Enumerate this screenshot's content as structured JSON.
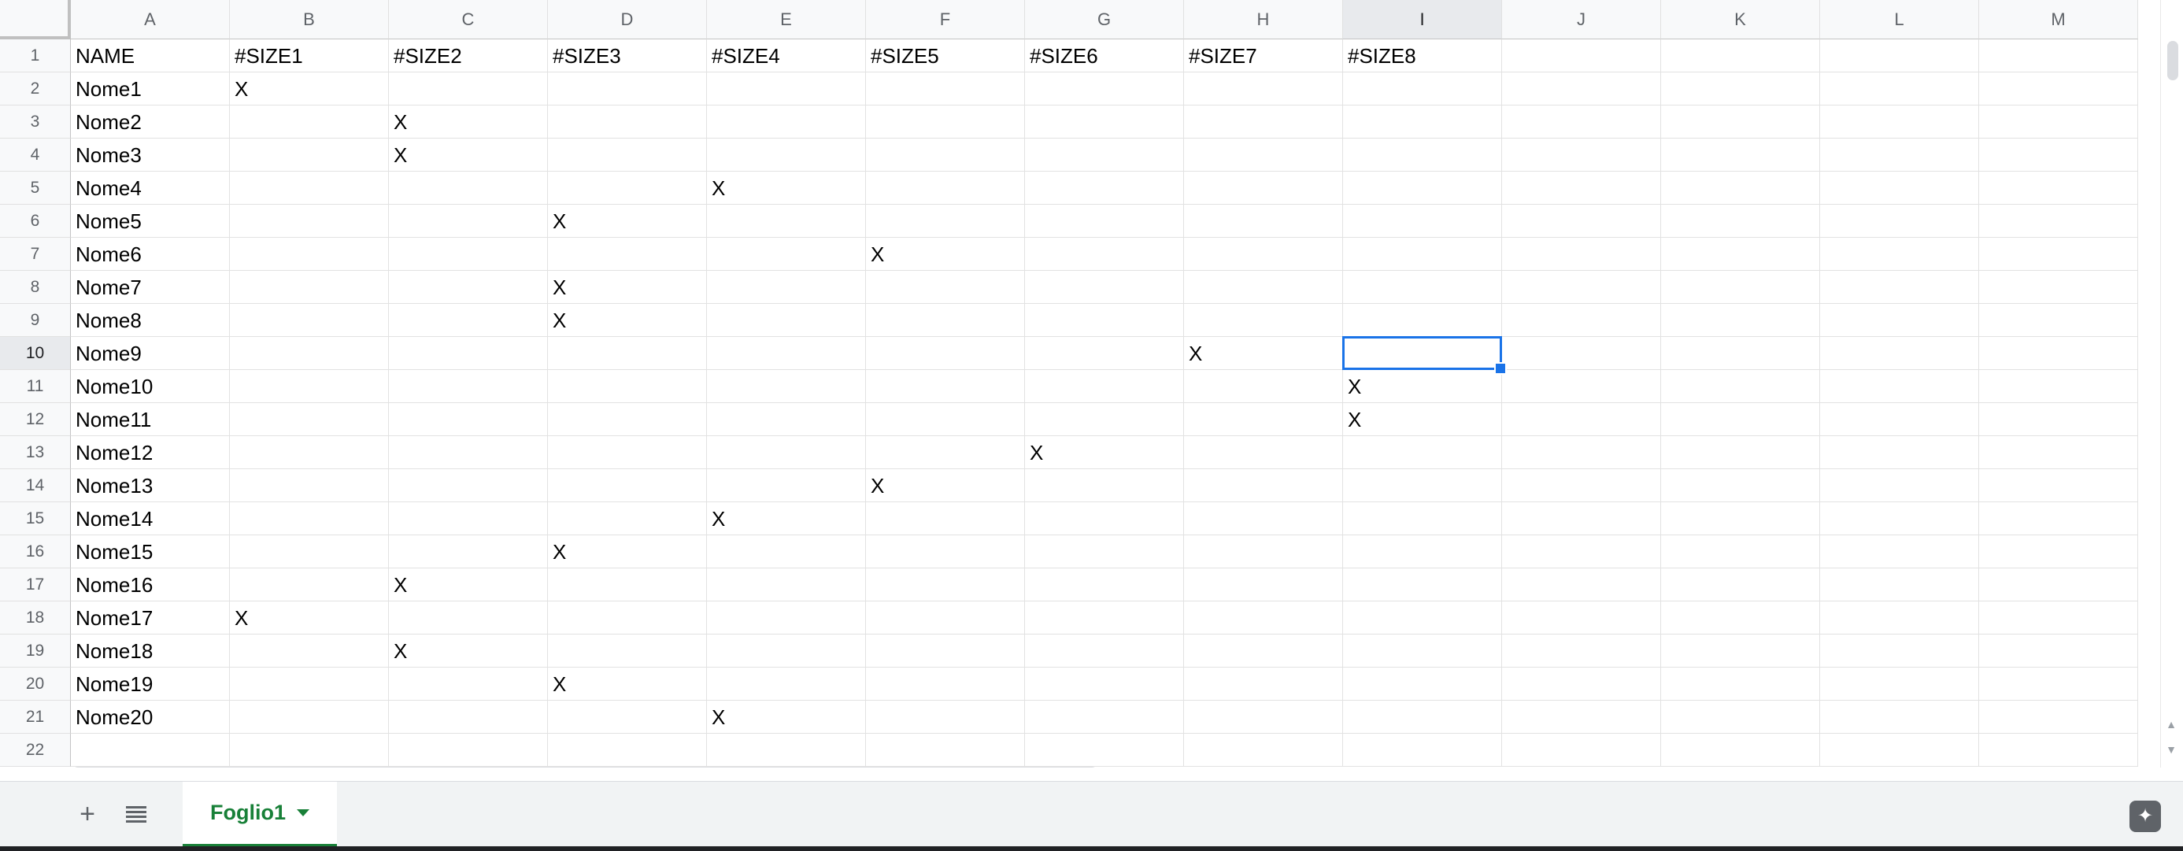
{
  "columns": [
    "A",
    "B",
    "C",
    "D",
    "E",
    "F",
    "G",
    "H",
    "I",
    "J",
    "K",
    "L",
    "M"
  ],
  "rows": [
    "1",
    "2",
    "3",
    "4",
    "5",
    "6",
    "7",
    "8",
    "9",
    "10",
    "11",
    "12",
    "13",
    "14",
    "15",
    "16",
    "17",
    "18",
    "19",
    "20",
    "21",
    "22"
  ],
  "cells": [
    [
      "NAME",
      "#SIZE1",
      "#SIZE2",
      "#SIZE3",
      "#SIZE4",
      "#SIZE5",
      "#SIZE6",
      "#SIZE7",
      "#SIZE8",
      "",
      "",
      "",
      ""
    ],
    [
      "Nome1",
      "X",
      "",
      "",
      "",
      "",
      "",
      "",
      "",
      "",
      "",
      "",
      ""
    ],
    [
      "Nome2",
      "",
      "X",
      "",
      "",
      "",
      "",
      "",
      "",
      "",
      "",
      "",
      ""
    ],
    [
      "Nome3",
      "",
      "X",
      "",
      "",
      "",
      "",
      "",
      "",
      "",
      "",
      "",
      ""
    ],
    [
      "Nome4",
      "",
      "",
      "",
      "X",
      "",
      "",
      "",
      "",
      "",
      "",
      "",
      ""
    ],
    [
      "Nome5",
      "",
      "",
      "X",
      "",
      "",
      "",
      "",
      "",
      "",
      "",
      "",
      ""
    ],
    [
      "Nome6",
      "",
      "",
      "",
      "",
      "X",
      "",
      "",
      "",
      "",
      "",
      "",
      ""
    ],
    [
      "Nome7",
      "",
      "",
      "X",
      "",
      "",
      "",
      "",
      "",
      "",
      "",
      "",
      ""
    ],
    [
      "Nome8",
      "",
      "",
      "X",
      "",
      "",
      "",
      "",
      "",
      "",
      "",
      "",
      ""
    ],
    [
      "Nome9",
      "",
      "",
      "",
      "",
      "",
      "",
      "X",
      "",
      "",
      "",
      "",
      ""
    ],
    [
      "Nome10",
      "",
      "",
      "",
      "",
      "",
      "",
      "",
      "X",
      "",
      "",
      "",
      ""
    ],
    [
      "Nome11",
      "",
      "",
      "",
      "",
      "",
      "",
      "",
      "X",
      "",
      "",
      "",
      ""
    ],
    [
      "Nome12",
      "",
      "",
      "",
      "",
      "",
      "X",
      "",
      "",
      "",
      "",
      "",
      ""
    ],
    [
      "Nome13",
      "",
      "",
      "",
      "",
      "X",
      "",
      "",
      "",
      "",
      "",
      "",
      ""
    ],
    [
      "Nome14",
      "",
      "",
      "",
      "X",
      "",
      "",
      "",
      "",
      "",
      "",
      "",
      ""
    ],
    [
      "Nome15",
      "",
      "",
      "X",
      "",
      "",
      "",
      "",
      "",
      "",
      "",
      "",
      ""
    ],
    [
      "Nome16",
      "",
      "X",
      "",
      "",
      "",
      "",
      "",
      "",
      "",
      "",
      "",
      ""
    ],
    [
      "Nome17",
      "X",
      "",
      "",
      "",
      "",
      "",
      "",
      "",
      "",
      "",
      "",
      ""
    ],
    [
      "Nome18",
      "",
      "X",
      "",
      "",
      "",
      "",
      "",
      "",
      "",
      "",
      "",
      ""
    ],
    [
      "Nome19",
      "",
      "",
      "X",
      "",
      "",
      "",
      "",
      "",
      "",
      "",
      "",
      ""
    ],
    [
      "Nome20",
      "",
      "",
      "",
      "X",
      "",
      "",
      "",
      "",
      "",
      "",
      "",
      ""
    ],
    [
      "",
      "",
      "",
      "",
      "",
      "",
      "",
      "",
      "",
      "",
      "",
      "",
      ""
    ]
  ],
  "selected_cell": {
    "column": "I",
    "row": "10"
  },
  "sheet_tabs": [
    {
      "label": "Foglio1",
      "active": true
    }
  ],
  "bottom_bar": {
    "add_sheet_icon": "plus-icon",
    "all_sheets_icon": "list-icon",
    "explore_icon": "sparkle-icon"
  },
  "colors": {
    "accent": "#1a73e8",
    "sheet_tab": "#188038",
    "header_bg": "#f8f9fa"
  }
}
